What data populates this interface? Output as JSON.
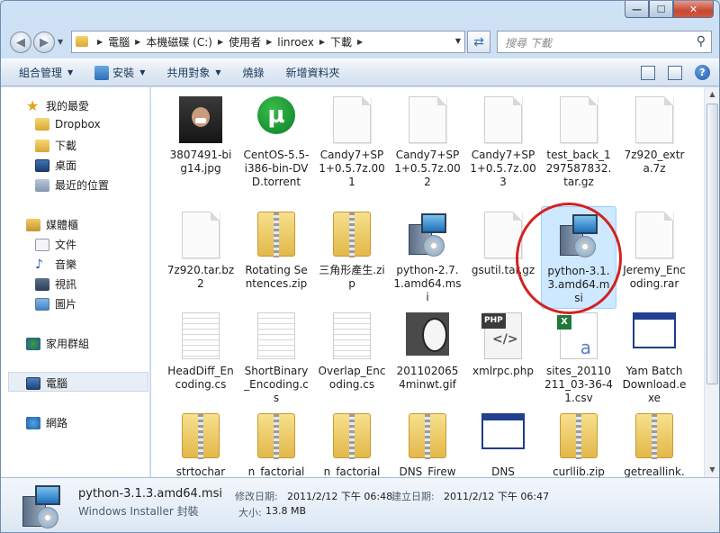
{
  "window": {
    "min_label": "—",
    "max_label": "☐",
    "close_label": "✕"
  },
  "address": {
    "crumbs": [
      "電腦",
      "本機磁碟 (C:)",
      "使用者",
      "linroex",
      "下載"
    ],
    "search_placeholder": "搜尋 下載"
  },
  "toolbar": {
    "organize": "組合管理",
    "install": "安裝",
    "share": "共用對象",
    "burn": "燒錄",
    "new_folder": "新增資料夾",
    "help": "?"
  },
  "navpane": {
    "favorites": "我的最愛",
    "dropbox": "Dropbox",
    "downloads": "下載",
    "desktop": "桌面",
    "recent": "最近的位置",
    "libraries": "媒體櫃",
    "documents": "文件",
    "music": "音樂",
    "videos": "視訊",
    "pictures": "圖片",
    "homegroup": "家用群組",
    "computer": "電腦",
    "network": "網路"
  },
  "files": [
    {
      "name": "3807491-big14.jpg",
      "icon": "photo-icon"
    },
    {
      "name": "CentOS-5.5-i386-bin-DVD.torrent",
      "icon": "utorrent-icon"
    },
    {
      "name": "Candy7+SP1+0.5.7z.001",
      "icon": "blank-file-icon"
    },
    {
      "name": "Candy7+SP1+0.5.7z.002",
      "icon": "blank-file-icon"
    },
    {
      "name": "Candy7+SP1+0.5.7z.003",
      "icon": "blank-file-icon"
    },
    {
      "name": "test_back_1297587832.tar.gz",
      "icon": "blank-file-icon"
    },
    {
      "name": "7z920_extra.7z",
      "icon": "blank-file-icon"
    },
    {
      "name": "7z920.tar.bz2",
      "icon": "blank-file-icon"
    },
    {
      "name": "Rotating Sentences.zip",
      "icon": "zip-folder-icon"
    },
    {
      "name": "三角形產生.zip",
      "icon": "zip-folder-icon"
    },
    {
      "name": "python-2.7.1.amd64.msi",
      "icon": "installer-icon"
    },
    {
      "name": "gsutil.tar.gz",
      "icon": "blank-file-icon"
    },
    {
      "name": "python-3.1.3.amd64.msi",
      "icon": "installer-icon"
    },
    {
      "name": "Jeremy_Encoding.rar",
      "icon": "blank-file-icon"
    },
    {
      "name": "HeadDiff_Encoding.cs",
      "icon": "text-file-icon"
    },
    {
      "name": "ShortBinary_Encoding.cs",
      "icon": "text-file-icon"
    },
    {
      "name": "Overlap_Encoding.cs",
      "icon": "text-file-icon"
    },
    {
      "name": "2011020654minwt.gif",
      "icon": "gif-image-icon"
    },
    {
      "name": "xmlrpc.php",
      "icon": "php-file-icon"
    },
    {
      "name": "sites_20110211_03-36-41.csv",
      "icon": "excel-csv-icon"
    },
    {
      "name": "Yam Batch Download.exe",
      "icon": "application-window-icon"
    },
    {
      "name": "strtochar",
      "icon": "zip-folder-icon"
    },
    {
      "name": "n_factorial",
      "icon": "zip-folder-icon"
    },
    {
      "name": "n_factorial",
      "icon": "zip-folder-icon"
    },
    {
      "name": "DNS_Firew",
      "icon": "zip-folder-icon"
    },
    {
      "name": "DNS",
      "icon": "application-window-icon"
    },
    {
      "name": "curllib.zip",
      "icon": "zip-folder-icon"
    },
    {
      "name": "getreallink.",
      "icon": "zip-folder-icon"
    }
  ],
  "details": {
    "name": "python-3.1.3.amd64.msi",
    "type": "Windows Installer 封裝",
    "modified_label": "修改日期:",
    "modified_value": "2011/2/12 下午 06:48",
    "created_label": "建立日期:",
    "created_value": "2011/2/12 下午 06:47",
    "size_label": "大小:",
    "size_value": "13.8 MB"
  },
  "colors": {
    "selection_fill": "#cde8ff",
    "annotation_circle": "#d32222",
    "toolbar_text": "#1e395b"
  }
}
